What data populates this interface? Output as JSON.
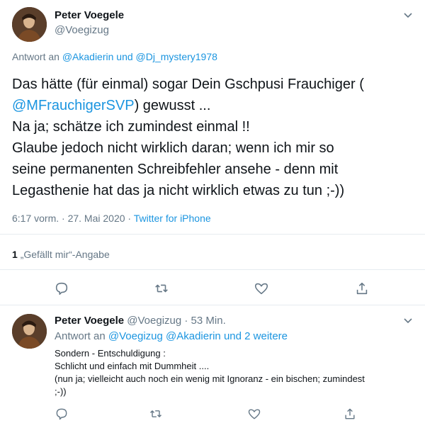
{
  "main_tweet": {
    "author_name": "Peter Voegele",
    "author_handle": "@Voegizug",
    "reply_prefix": "Antwort an",
    "reply_to_1": "@Akadierin",
    "reply_and": "und",
    "reply_to_2": "@Dj_mystery1978",
    "text_line1": "Das hätte (für einmal) sogar Dein Gschpusi Frauchiger (",
    "text_mention": "@MFrauchigerSVP",
    "text_line2_rest": ") gewusst ...",
    "text_line3": "Na ja; schätze ich zumindest einmal !!",
    "text_line4": "Glaube jedoch nicht wirklich daran; wenn ich mir so",
    "text_line5": "seine permanenten Schreibfehler ansehe - denn mit",
    "text_line6": "Legasthenie hat das ja nicht wirklich etwas zu tun ;-))",
    "timestamp": "6:17 vorm. · 27. Mai 2020 ·",
    "source": "Twitter for iPhone",
    "likes_count": "1",
    "likes_label": "„Gefällt mir“-Angabe"
  },
  "reply_tweet": {
    "author_name": "Peter Voegele",
    "author_handle": "@Voegizug · 53 Min.",
    "reply_prefix": "Antwort an",
    "reply_to_1": "@Voegizug",
    "reply_to_2": "@Akadierin",
    "reply_and": "und",
    "reply_more": "2 weitere",
    "line1": "Sondern - Entschuldigung :",
    "line2": "Schlicht und einfach mit Dummheit ....",
    "line3": "(nun ja; vielleicht auch noch ein wenig mit Ignoranz - ein bischen; zumindest",
    "line4": ";-))"
  },
  "icons": {
    "reply": "comment-icon",
    "retweet": "retweet-icon",
    "like": "heart-icon",
    "share": "share-icon",
    "menu": "chevron-down-icon"
  },
  "colors": {
    "link": "#1b95e0",
    "muted": "#657786",
    "divider": "#e6ecf0"
  }
}
